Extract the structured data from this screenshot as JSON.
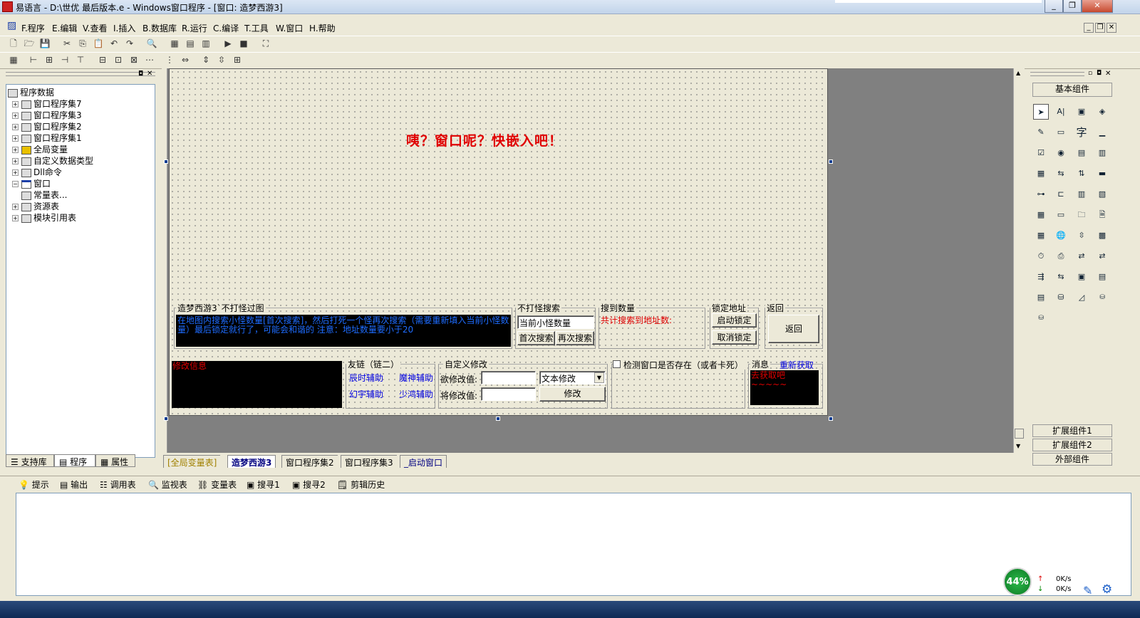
{
  "window": {
    "title": "易语言 - D:\\世优 最后版本.e - Windows窗口程序 - [窗口: 造梦西游3]"
  },
  "menu": [
    "F.程序",
    "E.编辑",
    "V.查看",
    "I.插入",
    "B.数据库",
    "R.运行",
    "C.编译",
    "T.工具",
    "W.窗口",
    "H.帮助"
  ],
  "tree": {
    "root": "程序数据",
    "items": [
      "窗口程序集7",
      "窗口程序集3",
      "窗口程序集2",
      "窗口程序集1",
      "全局变量",
      "自定义数据类型",
      "Dll命令",
      "窗口",
      "常量表...",
      "资源表",
      "模块引用表"
    ]
  },
  "left_tabs": [
    "支持库",
    "程序",
    "属性"
  ],
  "designer": {
    "prompt": "咦？窗口呢？快嵌入吧！",
    "group_main": "造梦西游3`不打怪过图",
    "info_text": "在地图内搜索小怪数量[首次搜索]，然后打死一个怪再次搜索（需要重新填入当前小怪数量）最后锁定就行了，可能会和谐的 注意：地址数量要小于20",
    "group_search": "不打怪搜索",
    "search_input": "当前小怪数量",
    "btn_first": "首次搜索",
    "btn_again": "再次搜索",
    "group_found": "搜到数量",
    "found_text": "共计搜索到地址数:",
    "group_lock": "锁定地址",
    "btn_lock": "启动锁定",
    "btn_unlock": "取消锁定",
    "group_back": "返回",
    "btn_back": "返回",
    "modify_info": "修改信息",
    "group_links": "友链（链二）",
    "links": [
      "辰时辅助",
      "魔神辅助",
      "幻宇辅助",
      "少鸿辅助"
    ],
    "group_custom": "自定义修改",
    "label_want": "欲修改值:",
    "label_will": "将修改值:",
    "select_type": "文本修改",
    "btn_modify": "修改",
    "check_window": "检测窗口是否存在（或者卡死）",
    "msg_label": "消息",
    "msg_refresh": "重新获取",
    "msg_text": "去获取吧~~~~~"
  },
  "doc_tabs": [
    "[全局变量表]",
    "造梦西游3",
    "窗口程序集2",
    "窗口程序集3",
    "_启动窗口"
  ],
  "right_panel": {
    "header": "基本组件",
    "footer": [
      "扩展组件1",
      "扩展组件2",
      "外部组件"
    ]
  },
  "bottom_tabs": [
    "提示",
    "输出",
    "调用表",
    "监视表",
    "变量表",
    "搜寻1",
    "搜寻2",
    "剪辑历史"
  ],
  "net": {
    "percent": "44%",
    "up": "0K/s",
    "down": "0K/s"
  },
  "colors": {
    "accent_red": "#e00000",
    "link_blue": "#0000e0",
    "info_blue": "#1e6cff"
  }
}
